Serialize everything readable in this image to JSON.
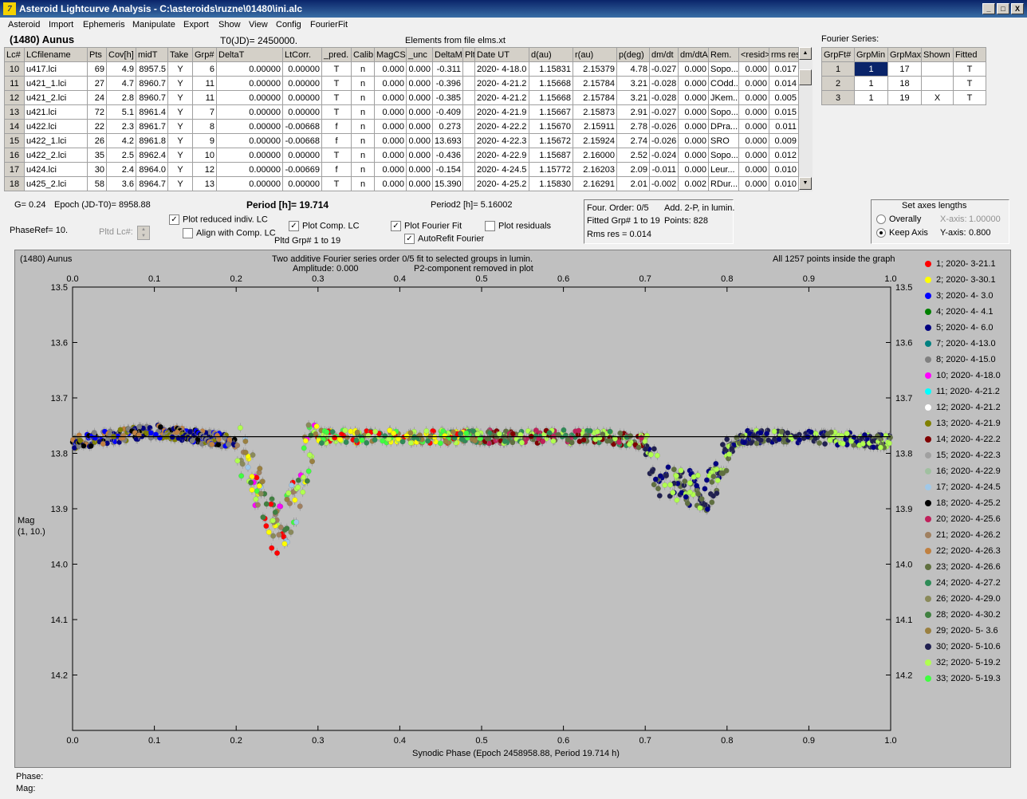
{
  "window": {
    "title": "Asteroid Lightcurve Analysis - C:\\asteroids\\ruzne\\01480\\ini.alc",
    "btn_min": "_",
    "btn_max": "□",
    "btn_close": "X"
  },
  "menu": [
    "Asteroid",
    "Import",
    "Ephemeris",
    "Manipulate",
    "Export",
    "Show",
    "View",
    "Config",
    "FourierFit"
  ],
  "header": {
    "asteroid_name": "(1480) Aunus",
    "t0": "T0(JD)= 2450000.",
    "elements": "Elements from file elms.xt"
  },
  "lc_table": {
    "columns": [
      "Lc#",
      "LCfilename",
      "Pts",
      "Cov[h]",
      "midT",
      "Take",
      "Grp#",
      "DeltaT",
      "LtCorr.",
      "_pred.",
      "Calib.",
      "MagCS",
      "_unc",
      "DeltaM",
      "Plt",
      "Date UT",
      "d(au)",
      "r(au)",
      "p(deg)",
      "dm/dt",
      "dm/dtA",
      "Rem.",
      "<resid>",
      "rms res"
    ],
    "rows": [
      [
        "10",
        "u417.lci",
        "69",
        "4.9",
        "8957.5",
        "Y",
        "6",
        "0.00000",
        "0.00000",
        "T",
        "n",
        "0.000",
        "0.000",
        "-0.311",
        "",
        "2020- 4-18.0",
        "1.15831",
        "2.15379",
        "4.78",
        "-0.027",
        "0.000",
        "Sopo...",
        "0.000",
        "0.017"
      ],
      [
        "11",
        "u421_1.lci",
        "27",
        "4.7",
        "8960.7",
        "Y",
        "11",
        "0.00000",
        "0.00000",
        "T",
        "n",
        "0.000",
        "0.000",
        "-0.396",
        "",
        "2020- 4-21.2",
        "1.15668",
        "2.15784",
        "3.21",
        "-0.028",
        "0.000",
        "COdd...",
        "0.000",
        "0.014"
      ],
      [
        "12",
        "u421_2.lci",
        "24",
        "2.8",
        "8960.7",
        "Y",
        "11",
        "0.00000",
        "0.00000",
        "T",
        "n",
        "0.000",
        "0.000",
        "-0.385",
        "",
        "2020- 4-21.2",
        "1.15668",
        "2.15784",
        "3.21",
        "-0.028",
        "0.000",
        "JKem...",
        "0.000",
        "0.005"
      ],
      [
        "13",
        "u421.lci",
        "72",
        "5.1",
        "8961.4",
        "Y",
        "7",
        "0.00000",
        "0.00000",
        "T",
        "n",
        "0.000",
        "0.000",
        "-0.409",
        "",
        "2020- 4-21.9",
        "1.15667",
        "2.15873",
        "2.91",
        "-0.027",
        "0.000",
        "Sopo...",
        "0.000",
        "0.015"
      ],
      [
        "14",
        "u422.lci",
        "22",
        "2.3",
        "8961.7",
        "Y",
        "8",
        "0.00000",
        "-0.00668",
        "f",
        "n",
        "0.000",
        "0.000",
        "0.273",
        "",
        "2020- 4-22.2",
        "1.15670",
        "2.15911",
        "2.78",
        "-0.026",
        "0.000",
        "DPra...",
        "0.000",
        "0.011"
      ],
      [
        "15",
        "u422_1.lci",
        "26",
        "4.2",
        "8961.8",
        "Y",
        "9",
        "0.00000",
        "-0.00668",
        "f",
        "n",
        "0.000",
        "0.000",
        "13.693",
        "",
        "2020- 4-22.3",
        "1.15672",
        "2.15924",
        "2.74",
        "-0.026",
        "0.000",
        "SRO",
        "0.000",
        "0.009"
      ],
      [
        "16",
        "u422_2.lci",
        "35",
        "2.5",
        "8962.4",
        "Y",
        "10",
        "0.00000",
        "0.00000",
        "T",
        "n",
        "0.000",
        "0.000",
        "-0.436",
        "",
        "2020- 4-22.9",
        "1.15687",
        "2.16000",
        "2.52",
        "-0.024",
        "0.000",
        "Sopo...",
        "0.000",
        "0.012"
      ],
      [
        "17",
        "u424.lci",
        "30",
        "2.4",
        "8964.0",
        "Y",
        "12",
        "0.00000",
        "-0.00669",
        "f",
        "n",
        "0.000",
        "0.000",
        "-0.154",
        "",
        "2020- 4-24.5",
        "1.15772",
        "2.16203",
        "2.09",
        "-0.011",
        "0.000",
        "Leur...",
        "0.000",
        "0.010"
      ],
      [
        "18",
        "u425_2.lci",
        "58",
        "3.6",
        "8964.7",
        "Y",
        "13",
        "0.00000",
        "0.00000",
        "T",
        "n",
        "0.000",
        "0.000",
        "15.390",
        "",
        "2020- 4-25.2",
        "1.15830",
        "2.16291",
        "2.01",
        "-0.002",
        "0.002",
        "RDur...",
        "0.000",
        "0.010"
      ]
    ]
  },
  "fourier_series": {
    "title": "Fourier Series:",
    "columns": [
      "GrpFt#",
      "GrpMin",
      "GrpMax",
      "Shown",
      "Fitted"
    ],
    "rows": [
      [
        "1",
        "1",
        "17",
        "",
        "T"
      ],
      [
        "2",
        "1",
        "18",
        "",
        "T"
      ],
      [
        "3",
        "1",
        "19",
        "X",
        "T"
      ]
    ]
  },
  "params": {
    "g": "G= 0.24",
    "epoch": "Epoch (JD-T0)= 8958.88",
    "period": "Period [h]= 19.714",
    "period2": "Period2 [h]= 5.16002",
    "phaseref": "PhaseRef= 10.",
    "pltd_lc": "Pltd Lc#:"
  },
  "checks": {
    "plot_reduced": {
      "label": "Plot reduced indiv. LC",
      "checked": "✓"
    },
    "align_comp": {
      "label": "Align with Comp. LC",
      "checked": ""
    },
    "plot_comp": {
      "label": "Plot Comp. LC",
      "checked": "✓"
    },
    "pltd_grp": "Pltd Grp#  1   to   19",
    "plot_fourier": {
      "label": "Plot Fourier Fit",
      "checked": "✓"
    },
    "autorefit": {
      "label": "AutoRefit Fourier",
      "checked": "✓"
    },
    "plot_residuals": {
      "label": "Plot residuals",
      "checked": ""
    }
  },
  "fit_info": {
    "order": "Four. Order:  0/5",
    "add": "Add. 2-P, in lumin.",
    "fitted": "Fitted Grp# 1 to 19",
    "points": "Points: 828",
    "rms": "Rms res     = 0.014"
  },
  "axes": {
    "title": "Set axes lengths",
    "overally": "Overally",
    "keep_axis": "Keep Axis",
    "xaxis_lbl": "X-axis:",
    "xaxis_val": "1.00000",
    "yaxis_lbl": "Y-axis:",
    "yaxis_val": "0.800"
  },
  "plot": {
    "name": "(1480) Aunus",
    "line1": "Two additive Fourier series order 0/5 fit to selected groups in lumin.",
    "line2": "Amplitude: 0.000",
    "line3": "P2-component removed in plot",
    "right": "All 1257 points inside the graph",
    "xlabel": "Synodic Phase (Epoch 2458958.88, Period 19.714 h)",
    "ylabel1": "Mag",
    "ylabel2": "(1, 10.)"
  },
  "chart_data": {
    "type": "scatter",
    "xlim": [
      0,
      1
    ],
    "ylim": [
      13.5,
      14.3
    ],
    "y_inverted": true,
    "xticks": [
      "0.0",
      "0.1",
      "0.2",
      "0.3",
      "0.4",
      "0.5",
      "0.6",
      "0.7",
      "0.8",
      "0.9",
      "1.0"
    ],
    "yticks": [
      "13.5",
      "13.6",
      "13.7",
      "13.8",
      "13.9",
      "14.0",
      "14.1",
      "14.2"
    ],
    "fit_line_y": 13.77,
    "legend": [
      {
        "name": "1; 2020- 3-21.1",
        "color": "#ff0000"
      },
      {
        "name": "2; 2020- 3-30.1",
        "color": "#ffff00"
      },
      {
        "name": "3; 2020- 4- 3.0",
        "color": "#0000ff"
      },
      {
        "name": "4; 2020- 4- 4.1",
        "color": "#008000"
      },
      {
        "name": "5; 2020- 4- 6.0",
        "color": "#000080"
      },
      {
        "name": "7; 2020- 4-13.0",
        "color": "#008080"
      },
      {
        "name": "8; 2020- 4-15.0",
        "color": "#808080"
      },
      {
        "name": "10; 2020- 4-18.0",
        "color": "#ff00ff"
      },
      {
        "name": "11; 2020- 4-21.2",
        "color": "#00ffff"
      },
      {
        "name": "12; 2020- 4-21.2",
        "color": "#ffffff"
      },
      {
        "name": "13; 2020- 4-21.9",
        "color": "#808000"
      },
      {
        "name": "14; 2020- 4-22.2",
        "color": "#800000"
      },
      {
        "name": "15; 2020- 4-22.3",
        "color": "#a0a0a0"
      },
      {
        "name": "16; 2020- 4-22.9",
        "color": "#a0c0a0"
      },
      {
        "name": "17; 2020- 4-24.5",
        "color": "#a0c8e8"
      },
      {
        "name": "18; 2020- 4-25.2",
        "color": "#000000"
      },
      {
        "name": "20; 2020- 4-25.6",
        "color": "#c0205a"
      },
      {
        "name": "21; 2020- 4-26.2",
        "color": "#a08060"
      },
      {
        "name": "22; 2020- 4-26.3",
        "color": "#c08040"
      },
      {
        "name": "23; 2020- 4-26.6",
        "color": "#607040"
      },
      {
        "name": "24; 2020- 4-27.2",
        "color": "#2e8b57"
      },
      {
        "name": "26; 2020- 4-29.0",
        "color": "#8a8a5a"
      },
      {
        "name": "28; 2020- 4-30.2",
        "color": "#408040"
      },
      {
        "name": "29; 2020- 5- 3.6",
        "color": "#9a8040"
      },
      {
        "name": "30; 2020- 5-10.6",
        "color": "#202050"
      },
      {
        "name": "32; 2020- 5-19.2",
        "color": "#b0ff50"
      },
      {
        "name": "33; 2020- 5-19.3",
        "color": "#40ff40"
      }
    ],
    "curve_points": [
      [
        0.0,
        13.78
      ],
      [
        0.05,
        13.77
      ],
      [
        0.1,
        13.76
      ],
      [
        0.15,
        13.77
      ],
      [
        0.2,
        13.78
      ],
      [
        0.21,
        13.8
      ],
      [
        0.22,
        13.84
      ],
      [
        0.23,
        13.88
      ],
      [
        0.24,
        13.92
      ],
      [
        0.25,
        13.94
      ],
      [
        0.26,
        13.93
      ],
      [
        0.27,
        13.9
      ],
      [
        0.28,
        13.84
      ],
      [
        0.29,
        13.79
      ],
      [
        0.3,
        13.77
      ],
      [
        0.4,
        13.77
      ],
      [
        0.5,
        13.77
      ],
      [
        0.6,
        13.77
      ],
      [
        0.65,
        13.77
      ],
      [
        0.7,
        13.78
      ],
      [
        0.71,
        13.82
      ],
      [
        0.72,
        13.85
      ],
      [
        0.75,
        13.86
      ],
      [
        0.77,
        13.88
      ],
      [
        0.78,
        13.86
      ],
      [
        0.8,
        13.8
      ],
      [
        0.82,
        13.77
      ],
      [
        0.9,
        13.77
      ],
      [
        1.0,
        13.78
      ]
    ]
  },
  "status": {
    "phase": "Phase:",
    "mag": "Mag:"
  }
}
